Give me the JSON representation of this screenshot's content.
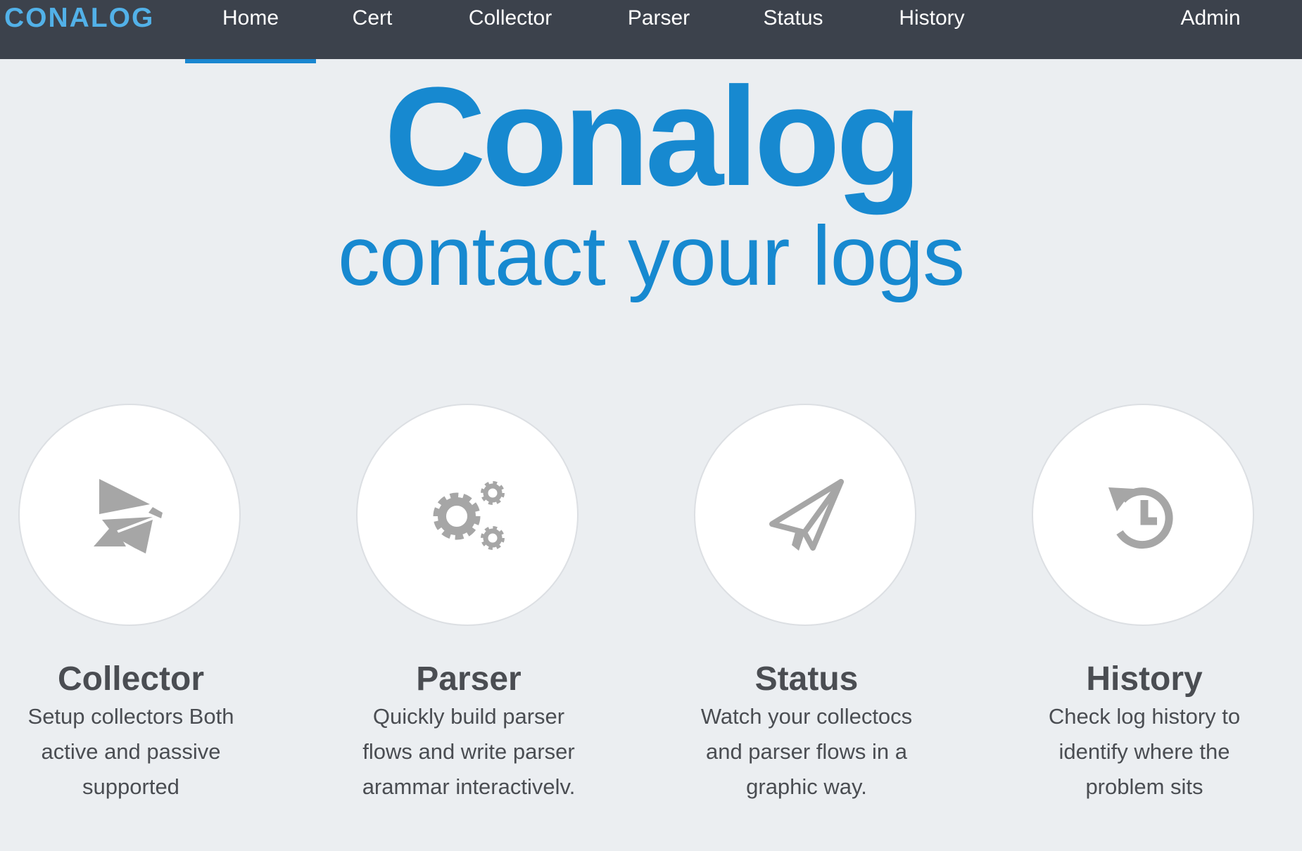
{
  "navbar": {
    "brand": "CONALOG",
    "items": [
      {
        "label": "Home",
        "active": true
      },
      {
        "label": "Cert"
      },
      {
        "label": "Collector"
      },
      {
        "label": "Parser"
      },
      {
        "label": "Status"
      },
      {
        "label": "History"
      },
      {
        "label": "Admin"
      }
    ]
  },
  "hero": {
    "title": "Conalog",
    "tagline": "contact your logs"
  },
  "features": [
    {
      "icon": "pinwheel-icon",
      "title": "Collector",
      "description": "Setup collectors Both active and passive supported"
    },
    {
      "icon": "gears-icon",
      "title": "Parser",
      "description": "Quickly build parser flows and write parser arammar interactivelv."
    },
    {
      "icon": "paper-plane-icon",
      "title": "Status",
      "description": "Watch your collectocs and parser flows in a graphic way."
    },
    {
      "icon": "history-icon",
      "title": "History",
      "description": "Check log history to identify where the problem sits"
    }
  ],
  "colors": {
    "navbar_bg": "#3c424c",
    "brand": "#52b1e8",
    "accent": "#1789d0",
    "page_bg": "#ebeef1",
    "icon": "#a6a6a6",
    "text": "#4a4d52"
  }
}
